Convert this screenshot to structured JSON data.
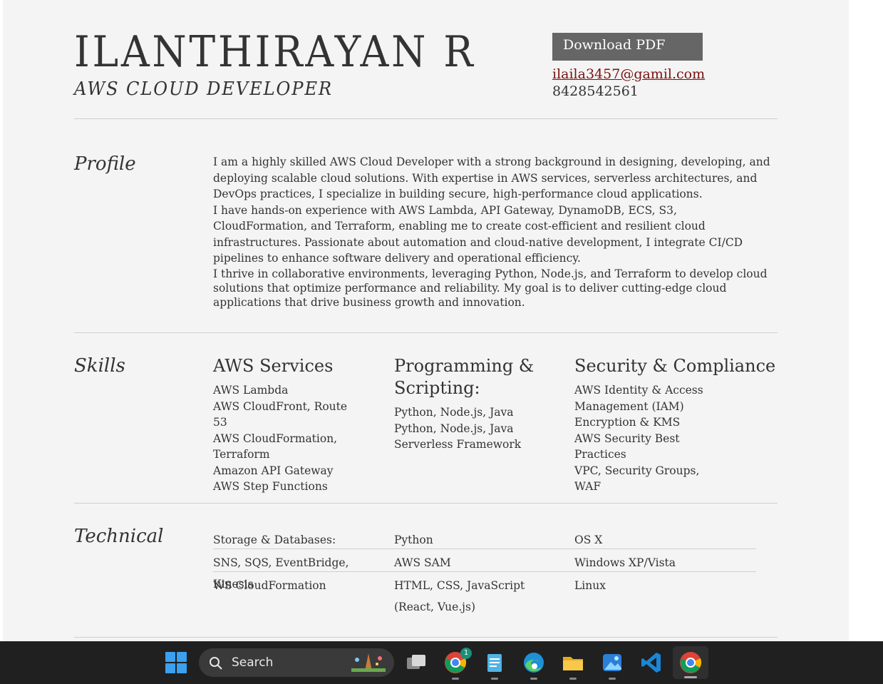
{
  "header": {
    "name": "ILANTHIRAYAN R",
    "role": "AWS CLOUD DEVELOPER",
    "download_label": "Download PDF",
    "email": "ilaila3457@gamil.com",
    "phone": "8428542561"
  },
  "profile": {
    "title": "Profile",
    "paragraphs": [
      "I am a highly skilled AWS Cloud Developer with a strong background in designing, developing, and deploying scalable cloud solutions. With expertise in AWS services, serverless architectures, and DevOps practices, I specialize in building secure, high-performance cloud applications.",
      "I have hands-on experience with AWS Lambda, API Gateway, DynamoDB, ECS, S3, CloudFormation, and Terraform, enabling me to create cost-efficient and resilient cloud infrastructures. Passionate about automation and cloud-native development, I integrate CI/CD pipelines to enhance software delivery and operational efficiency.",
      "I thrive in collaborative environments, leveraging Python, Node.js, and Terraform to develop cloud solutions that optimize performance and reliability. My goal is to deliver cutting-edge cloud applications that drive business growth and innovation."
    ]
  },
  "skills": {
    "title": "Skills",
    "columns": [
      {
        "heading": "AWS Services",
        "items": [
          "AWS Lambda",
          "AWS CloudFront, Route 53",
          "AWS CloudFormation, Terraform",
          "Amazon API Gateway",
          "AWS Step Functions"
        ]
      },
      {
        "heading": "Programming & Scripting:",
        "items": [
          "Python, Node.js, Java",
          "Python, Node.js, Java",
          "Serverless Framework"
        ]
      },
      {
        "heading": "Security & Compliance",
        "items": [
          "AWS Identity & Access Management (IAM)",
          "Encryption & KMS",
          "AWS Security Best Practices",
          "VPC, Security Groups, WAF"
        ]
      }
    ]
  },
  "technical": {
    "title": "Technical",
    "rows": [
      [
        "Storage & Databases:",
        "Python",
        "OS X"
      ],
      [
        "SNS, SQS, EventBridge, Kinesis",
        "AWS SAM",
        "Windows XP/Vista"
      ],
      [
        "WS CloudFormation",
        "HTML, CSS, JavaScript (React, Vue.js)",
        "Linux"
      ]
    ]
  },
  "taskbar": {
    "search_label": "Search",
    "chrome_badge": "1",
    "apps": [
      "start-icon",
      "search-box",
      "task-view-icon",
      "chrome-icon",
      "notepad-icon",
      "edge-icon",
      "file-explorer-icon",
      "photos-icon",
      "vscode-icon",
      "chrome-active-icon"
    ]
  }
}
